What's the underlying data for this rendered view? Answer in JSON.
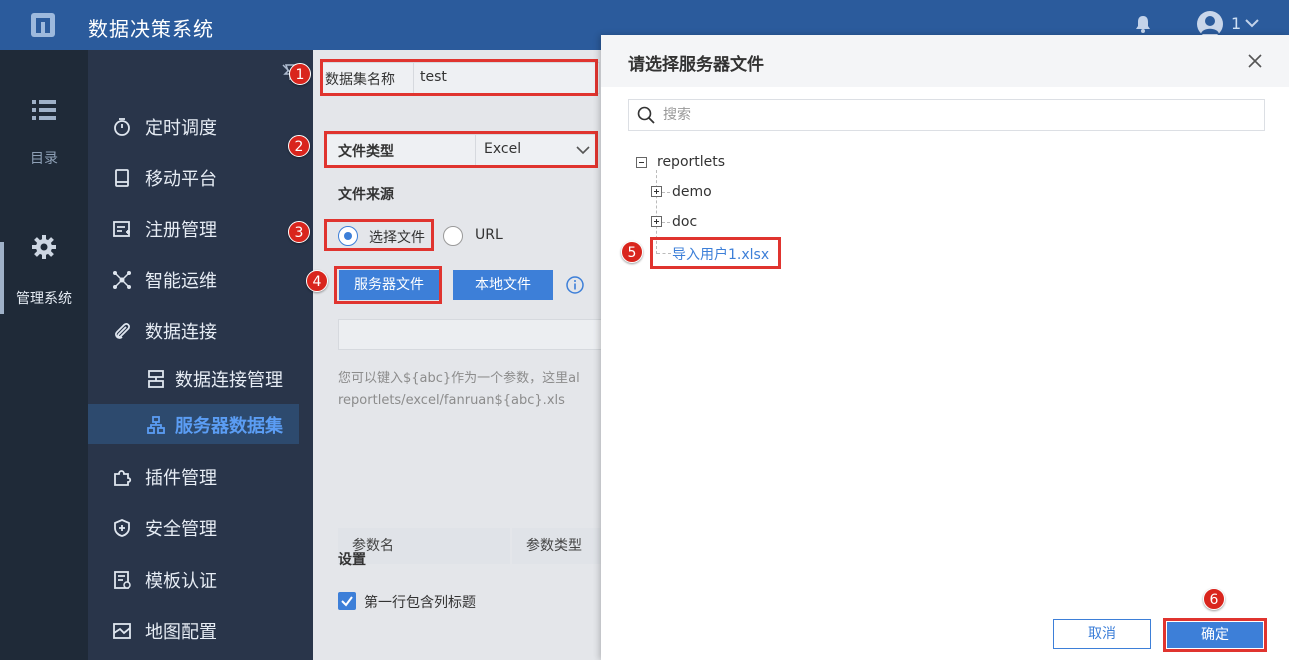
{
  "app": {
    "title": "数据决策系统",
    "user_name": "1"
  },
  "rail": [
    {
      "label": "目录",
      "icon": "list-icon"
    },
    {
      "label": "管理系统",
      "icon": "gear-icon"
    }
  ],
  "sidebar": {
    "items": [
      {
        "label": "定时调度",
        "icon": "timer-icon"
      },
      {
        "label": "移动平台",
        "icon": "tablet-icon"
      },
      {
        "label": "注册管理",
        "icon": "register-icon"
      },
      {
        "label": "智能运维",
        "icon": "network-icon"
      },
      {
        "label": "数据连接",
        "icon": "paperclip-icon"
      },
      {
        "label": "数据连接管理",
        "icon": "database-icon"
      },
      {
        "label": "服务器数据集",
        "icon": "dataset-icon"
      },
      {
        "label": "插件管理",
        "icon": "puzzle-icon"
      },
      {
        "label": "安全管理",
        "icon": "shield-icon"
      },
      {
        "label": "模板认证",
        "icon": "template-icon"
      },
      {
        "label": "地图配置",
        "icon": "map-icon"
      }
    ]
  },
  "form": {
    "dataset_name_label": "数据集名称",
    "dataset_name_value": "test",
    "file_type_label": "文件类型",
    "file_type_value": "Excel",
    "file_source_label": "文件来源",
    "radio_choose_file": "选择文件",
    "radio_url": "URL",
    "btn_server_file": "服务器文件",
    "btn_local_file": "本地文件",
    "hint_line1": "您可以键入${abc}作为一个参数，这里al",
    "hint_line2": "reportlets/excel/fanruan${abc}.xls",
    "table_headers": [
      "参数名",
      "参数类型"
    ],
    "settings_title": "设置",
    "checkbox_first_row": "第一行包含列标题"
  },
  "dialog": {
    "title": "请选择服务器文件",
    "search_placeholder": "搜索",
    "tree": {
      "root": "reportlets",
      "children": [
        "demo",
        "doc"
      ],
      "file": "导入用户1.xlsx"
    },
    "cancel_label": "取消",
    "ok_label": "确定"
  },
  "annotations": [
    "1",
    "2",
    "3",
    "4",
    "5",
    "6"
  ],
  "colors": {
    "topbar": "#2b5b9c",
    "accent": "#3d7fd8",
    "annotation_red": "#e0342f"
  }
}
